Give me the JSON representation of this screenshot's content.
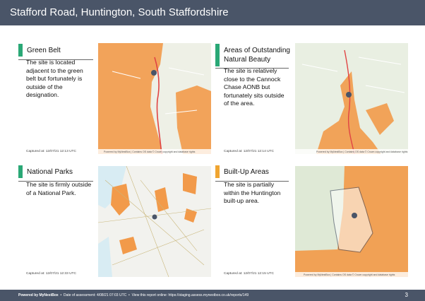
{
  "header": {
    "title": "Stafford Road, Huntington, South Staffordshire"
  },
  "colors": {
    "green": "#2aa876",
    "amber": "#f0a531",
    "overlay": "#f29a4a",
    "header_bg": "#4a5568"
  },
  "panels": [
    {
      "heading": "Green Belt",
      "status_color": "#2aa876",
      "description": "The site is located adjacent to the green belt but fortunately is outside of the designation.",
      "captured": "Captured at: 12/07/21 12:13 UTC"
    },
    {
      "heading": "Areas of Outstanding Natural Beauty",
      "status_color": "#2aa876",
      "description": "The site is relatively close to the Cannock Chase AONB but fortunately sits outside of the area.",
      "captured": "Captured at: 12/07/21 12:14 UTC"
    },
    {
      "heading": "National Parks",
      "status_color": "#2aa876",
      "description": "The site is firmly outside of a National Park.",
      "captured": "Captured at: 12/07/21 12:33 UTC"
    },
    {
      "heading": "Built-Up Areas",
      "status_color": "#f0a531",
      "description": "The site is partially within the Huntington built-up area.",
      "captured": "Captured at: 12/07/21 12:15 UTC"
    }
  ],
  "map_attribution": "Powered by MyNestBox | Contains OS data © Crown copyright and database rights",
  "footer": {
    "powered": "Powered by MyNestBox",
    "sep": "•",
    "date": "Date of assessment: 4/08/21 07:03 UTC",
    "link": "View this report online: https://staging.assess.mynestbox.co.uk/reports/149",
    "page": "3"
  }
}
